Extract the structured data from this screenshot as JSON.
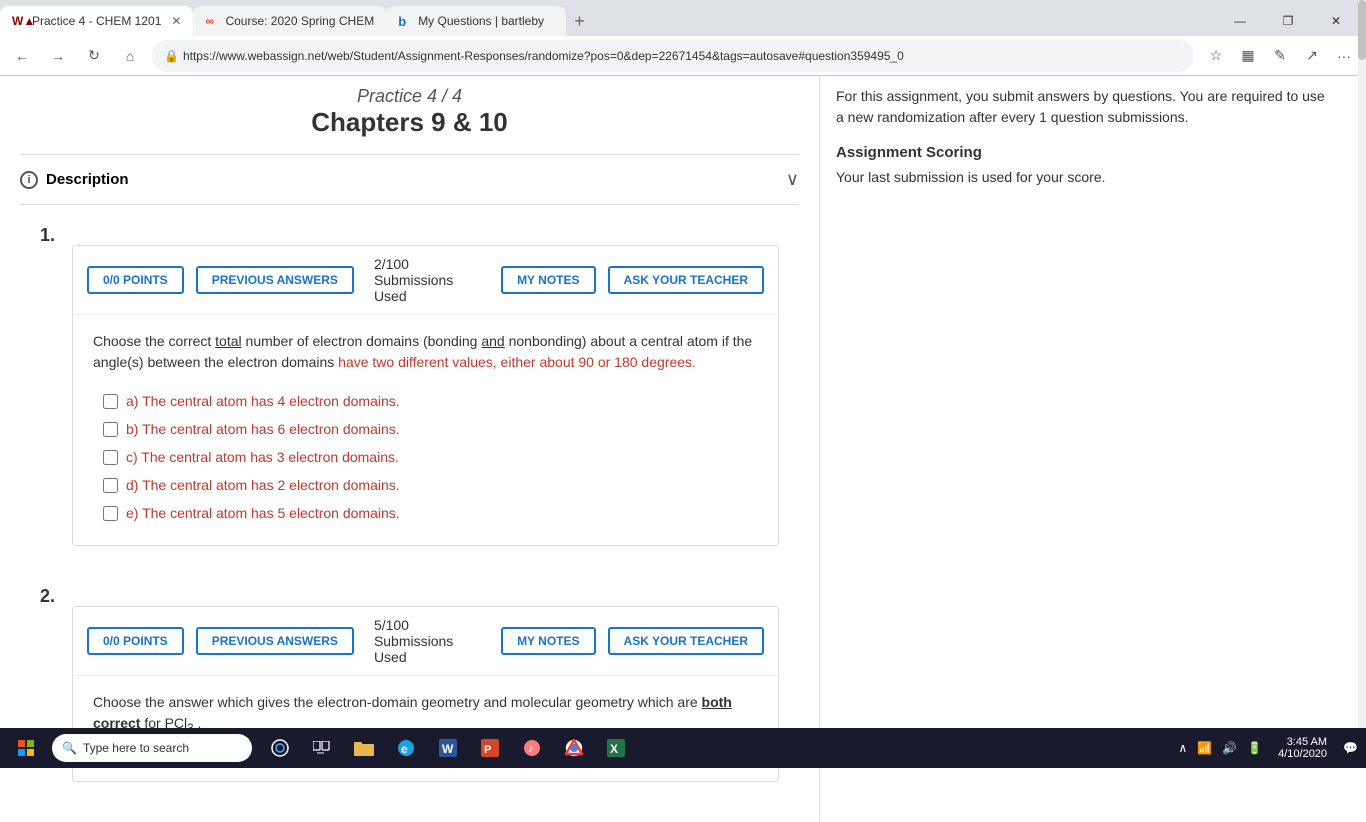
{
  "browser": {
    "tabs": [
      {
        "id": "tab1",
        "label": "Practice 4 - CHEM 1201",
        "favicon": "W",
        "active": true,
        "favicon_color": "#8B0000"
      },
      {
        "id": "tab2",
        "label": "Course: 2020 Spring CHEM",
        "favicon": "∞",
        "active": false,
        "favicon_color": "#e44d26"
      },
      {
        "id": "tab3",
        "label": "My Questions | bartleby",
        "favicon": "b",
        "active": false,
        "favicon_color": "#1a73c5"
      }
    ],
    "url": "https://www.webassign.net/web/Student/Assignment-Responses/randomize?pos=0&dep=22671454&tags=autosave#question359495_0",
    "window_controls": [
      "—",
      "❐",
      "✕"
    ]
  },
  "page": {
    "title_small": "Practice 4 / 4",
    "title_main": "Chapters 9 & 10"
  },
  "description": {
    "label": "Description",
    "chevron": "∨"
  },
  "sidebar": {
    "intro_text": "For this assignment, you submit answers by questions. You are required to use a new randomization after every 1 question submissions.",
    "scoring_title": "Assignment Scoring",
    "scoring_text": "Your last submission is used for your score."
  },
  "questions": [
    {
      "number": "1.",
      "points_label": "0/0 POINTS",
      "prev_answers_label": "PREVIOUS ANSWERS",
      "submissions_used": "2/100 Submissions Used",
      "my_notes_label": "MY NOTES",
      "ask_teacher_label": "ASK YOUR TEACHER",
      "question_text_parts": [
        {
          "text": "Choose the correct ",
          "style": "normal"
        },
        {
          "text": "total",
          "style": "underline"
        },
        {
          "text": " number of electron domains (bonding ",
          "style": "normal"
        },
        {
          "text": "and",
          "style": "underline"
        },
        {
          "text": " nonbonding) about a central atom if the angle(s) between the electron domains ",
          "style": "normal"
        },
        {
          "text": "have two different values, either about 90 or 180 degrees.",
          "style": "red"
        }
      ],
      "options": [
        {
          "label": "a) The central atom has 4 electron domains.",
          "checked": false
        },
        {
          "label": "b) The central atom has 6 electron domains.",
          "checked": false
        },
        {
          "label": "c) The central atom has 3 electron domains.",
          "checked": false
        },
        {
          "label": "d) The central atom has 2 electron domains.",
          "checked": false
        },
        {
          "label": "e) The central atom has 5 electron domains.",
          "checked": false
        }
      ]
    },
    {
      "number": "2.",
      "points_label": "0/0 POINTS",
      "prev_answers_label": "PREVIOUS ANSWERS",
      "submissions_used": "5/100 Submissions Used",
      "my_notes_label": "MY NOTES",
      "ask_teacher_label": "ASK YOUR TEACHER",
      "question_text_parts": [
        {
          "text": "Choose the answer which gives the electron-domain geometry and molecular geometry which are ",
          "style": "normal"
        },
        {
          "text": "both correct",
          "style": "bold-underline"
        },
        {
          "text": " for PCl",
          "style": "normal"
        },
        {
          "text": "3",
          "style": "sub"
        },
        {
          "text": " .",
          "style": "normal"
        }
      ],
      "options": []
    }
  ],
  "taskbar": {
    "search_placeholder": "Type here to search",
    "time": "3:45 AM",
    "date": "4/10/2020",
    "app_icons": [
      "⊞",
      "○",
      "▭",
      "📁",
      "🌐",
      "W",
      "P",
      "♪",
      "🌐",
      "📊"
    ],
    "sys_icons": [
      "∧",
      "🔇",
      "📶",
      "🔋"
    ]
  }
}
